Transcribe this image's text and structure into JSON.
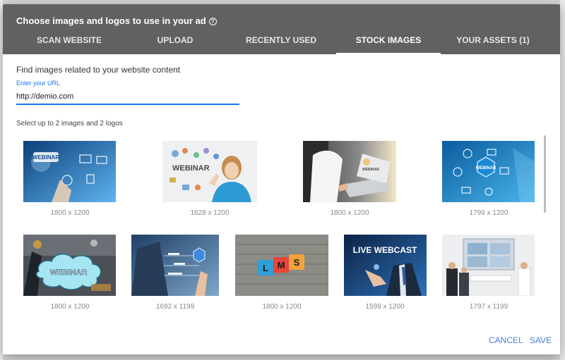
{
  "dialog": {
    "title": "Choose images and logos to use in your ad",
    "help_icon": "help-circle-icon",
    "tabs": [
      {
        "label": "SCAN WEBSITE",
        "active": false
      },
      {
        "label": "UPLOAD",
        "active": false
      },
      {
        "label": "RECENTLY USED",
        "active": false
      },
      {
        "label": "STOCK IMAGES",
        "active": true
      },
      {
        "label": "YOUR ASSETS (1)",
        "active": false
      }
    ]
  },
  "content": {
    "find_label": "Find images related to your website content",
    "url_label": "Enter your URL",
    "url_value": "http://demio.com",
    "select_label": "Select up to 2 images and 2 logos"
  },
  "images": [
    {
      "dims": "1800 x 1200",
      "caption": "WEBINAR"
    },
    {
      "dims": "1828 x 1200",
      "caption": "WEBINAR"
    },
    {
      "dims": "1800 x 1200",
      "caption": "WEBINAR"
    },
    {
      "dims": "1799 x 1200",
      "caption": "WEBINAR"
    },
    {
      "dims": "1800 x 1200",
      "caption": "WEBINAR"
    },
    {
      "dims": "1692 x 1199",
      "caption": ""
    },
    {
      "dims": "1800 x 1200",
      "caption": "LMS"
    },
    {
      "dims": "1599 x 1200",
      "caption": "LIVE WEBCAST"
    },
    {
      "dims": "1797 x 1199",
      "caption": ""
    }
  ],
  "actions": {
    "cancel": "CANCEL",
    "save": "SAVE"
  },
  "colors": {
    "header": "#616161",
    "accent": "#1a73e8",
    "action": "#4a7fd6"
  }
}
